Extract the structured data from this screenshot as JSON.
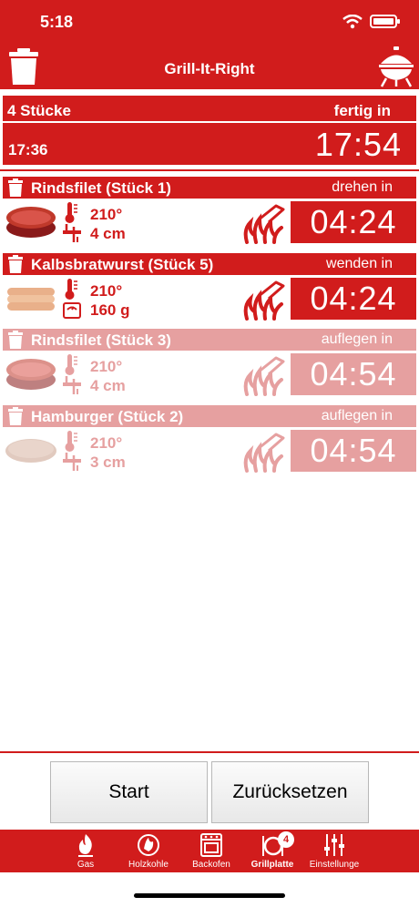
{
  "status": {
    "time": "5:18"
  },
  "header": {
    "title": "Grill-It-Right"
  },
  "summary": {
    "count": "4 Stücke",
    "ready_label": "fertig in",
    "start_time": "17:36",
    "end_time": "17:54"
  },
  "items": [
    {
      "name": "Rindsfilet (Stück 1)",
      "action": "drehen in",
      "temp": "210°",
      "size": "4 cm",
      "timer": "04:24",
      "faded": false,
      "meat": "steak",
      "measure": "thickness"
    },
    {
      "name": "Kalbsbratwurst (Stück 5)",
      "action": "wenden in",
      "temp": "210°",
      "size": "160 g",
      "timer": "04:24",
      "faded": false,
      "meat": "sausage",
      "measure": "weight"
    },
    {
      "name": "Rindsfilet (Stück 3)",
      "action": "auflegen in",
      "temp": "210°",
      "size": "4 cm",
      "timer": "04:54",
      "faded": true,
      "meat": "steak",
      "measure": "thickness"
    },
    {
      "name": "Hamburger (Stück 2)",
      "action": "auflegen in",
      "temp": "210°",
      "size": "3 cm",
      "timer": "04:54",
      "faded": true,
      "meat": "burger",
      "measure": "thickness"
    }
  ],
  "buttons": {
    "start": "Start",
    "reset": "Zurücksetzen"
  },
  "tabs": [
    {
      "label": "Gas",
      "icon": "gas-flame-icon"
    },
    {
      "label": "Holzkohle",
      "icon": "charcoal-icon"
    },
    {
      "label": "Backofen",
      "icon": "oven-icon"
    },
    {
      "label": "Grillplatte",
      "icon": "grill-plate-icon",
      "badge": "4",
      "active": true
    },
    {
      "label": "Einstellunge",
      "icon": "settings-sliders-icon"
    }
  ],
  "colors": {
    "accent": "#d11c1c",
    "faded": "#e6a0a0"
  }
}
